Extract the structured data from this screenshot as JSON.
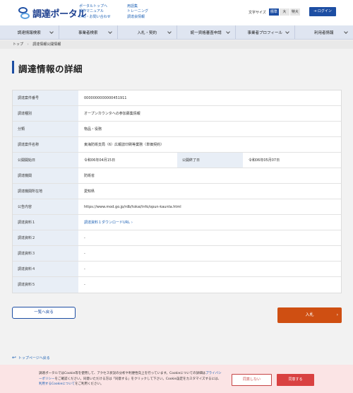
{
  "header": {
    "logo_text": "調達ポータル",
    "links_col1": [
      "ポータルトップへ",
      "操作マニュアル",
      "FAQ・お問い合わせ"
    ],
    "links_col2": [
      "用語集",
      "トレーニング",
      "調達会情報"
    ],
    "font_size_label": "文字サイズ",
    "font_sizes": [
      "標準",
      "大",
      "特大"
    ],
    "font_size_selected": "標準",
    "login_label": "ログイン"
  },
  "nav": {
    "items": [
      "調達情報検索",
      "事業者検索",
      "入札・契約",
      "統一資格審査申請",
      "事業者プロフィール",
      "利用者情報"
    ]
  },
  "breadcrumb": {
    "items": [
      "トップ",
      "調達情報公開情報"
    ]
  },
  "page": {
    "title": "調達情報の詳細"
  },
  "details": {
    "rows": [
      {
        "label": "調達案件番号",
        "value": "0000000000000451911"
      },
      {
        "label": "調達種別",
        "value": "オープンカウンタへの参加募集情報"
      },
      {
        "label": "分類",
        "value": "物品・役務"
      },
      {
        "label": "調達案件名称",
        "value": "東海防衛支局（6）広報誌印刷等業務（単価契約）"
      },
      {
        "label": "公開開始日",
        "value": "令和06年04月15日",
        "label2": "公開終了日",
        "value2": "令和06年05月07日"
      },
      {
        "label": "調達機関",
        "value": "防衛省"
      },
      {
        "label": "調達機関所在地",
        "value": "愛知県"
      },
      {
        "label": "公告内容",
        "value": "https://www.mod.go.jp/rdb/tokai/info/opun-kaunta.html"
      },
      {
        "label": "調達資料１",
        "value": "調達資料１ダウンロードURL"
      },
      {
        "label": "調達資料２",
        "value": "-"
      },
      {
        "label": "調達資料３",
        "value": "-"
      },
      {
        "label": "調達資料４",
        "value": "-"
      },
      {
        "label": "調達資料５",
        "value": "-"
      }
    ]
  },
  "actions": {
    "back_label": "一覧へ戻る",
    "bid_label": "入札",
    "top_label": "トップページへ戻る"
  },
  "cookie": {
    "text_1": "調達ポータルではCookie等を使用して、アクセス状況の分析や利便性向上を行っています。Cookieについての詳細は",
    "privacy_link": "プライバシーポリシー",
    "text_2": "をご確認ください。同意いただける方は「同意する」をクリックして下さい。Cookie設定をカスタマイズするには、",
    "settings_link": "利用するCookieについて",
    "text_3": "をご利用ください。",
    "decline_label": "同意しない",
    "agree_label": "同意する"
  },
  "colors": {
    "brand": "#1d4ea3",
    "bid": "#cf4f12",
    "cookie_bg": "#fbe4e5",
    "agree": "#d94141"
  }
}
